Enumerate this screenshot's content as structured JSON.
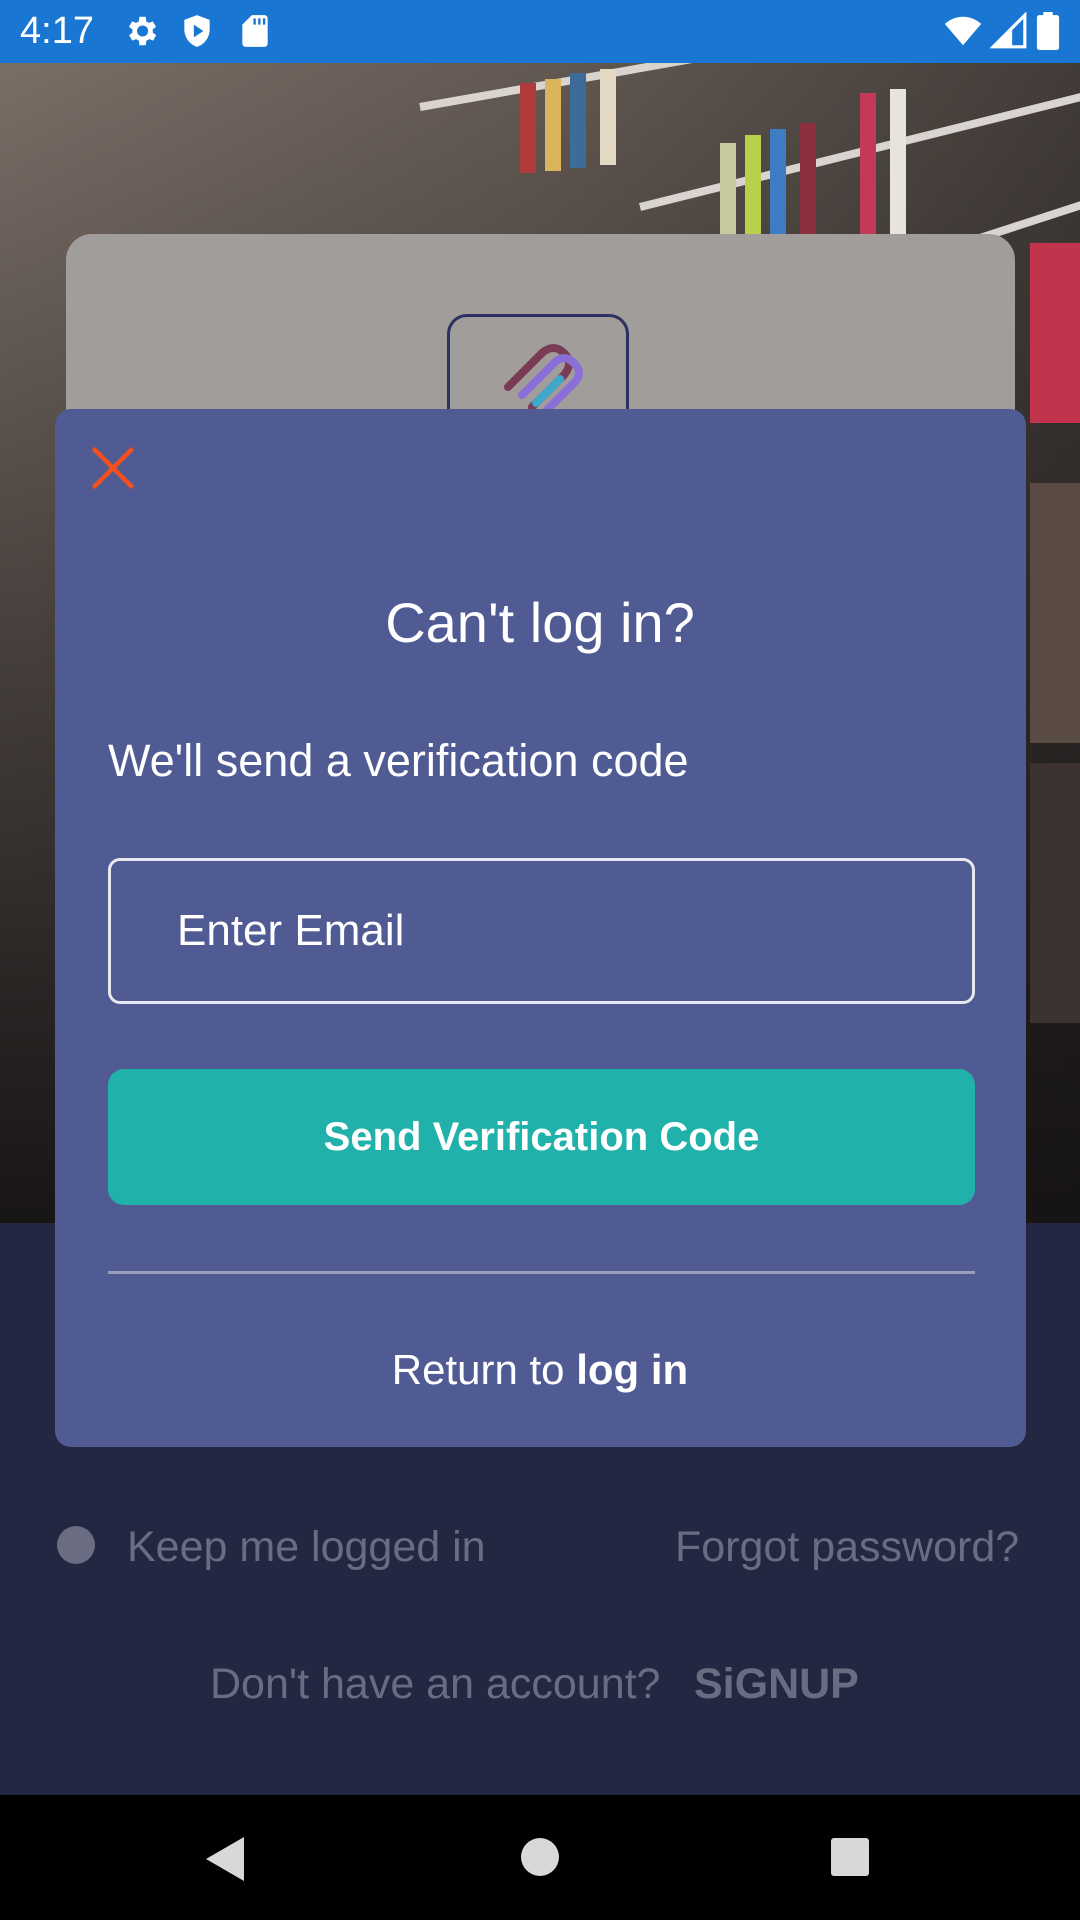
{
  "status_bar": {
    "time": "4:17",
    "icons": [
      "gear-icon",
      "shield-play-icon",
      "sd-card-icon",
      "wifi-icon",
      "signal-icon",
      "battery-icon"
    ]
  },
  "modal": {
    "title": "Can't log in?",
    "subtitle": "We'll send a verification code",
    "email_placeholder": "Enter Email",
    "send_button": "Send Verification Code",
    "return_prefix": "Return to",
    "return_link": "log in",
    "close_icon_color": "#f4511e"
  },
  "background_login": {
    "keep_logged_in": "Keep me logged in",
    "forgot_password": "Forgot password?",
    "no_account": "Don't have an account?",
    "signup": "SiGNUP"
  },
  "colors": {
    "status_bar": "#1976d2",
    "modal_bg": "#515b93",
    "button": "#20b2aa",
    "page_bg": "#242741"
  }
}
